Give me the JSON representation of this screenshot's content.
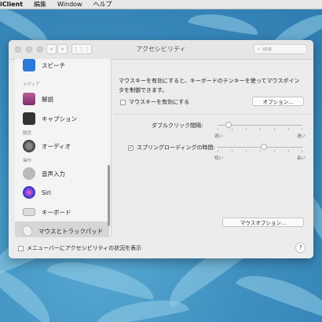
{
  "menubar": {
    "app_name": "iClient",
    "items": [
      "編集",
      "Window",
      "ヘルプ"
    ]
  },
  "window": {
    "title": "アクセシビリティ",
    "search_placeholder": "検索",
    "nav_back": "‹",
    "nav_forward": "›"
  },
  "sidebar": {
    "sections": {
      "media": "メディア",
      "hearing": "聴覚",
      "interaction": "操作"
    },
    "items": [
      {
        "label": "スピーチ",
        "icon": "speech-bubble-icon"
      },
      {
        "label": "解説",
        "icon": "descriptions-icon"
      },
      {
        "label": "キャプション",
        "icon": "captions-icon"
      },
      {
        "label": "オーディオ",
        "icon": "speaker-icon"
      },
      {
        "label": "音声入力",
        "icon": "microphone-icon"
      },
      {
        "label": "Siri",
        "icon": "siri-icon"
      },
      {
        "label": "キーボード",
        "icon": "keyboard-icon"
      },
      {
        "label": "マウスとトラックパッド",
        "icon": "mouse-icon"
      }
    ],
    "selected": "マウスとトラックパッド"
  },
  "main": {
    "mouse_keys_description": "マウスキーを有効にすると、キーボードのテンキーを使ってマウスポインタを制御できます。",
    "enable_mouse_keys_label": "マウスキーを有効にする",
    "enable_mouse_keys_checked": false,
    "options_button": "オプション...",
    "double_click_label": "ダブルクリック間隔:",
    "double_click_min": "遅い",
    "double_click_max": "速い",
    "double_click_value": 0.13,
    "spring_loading_label": "スプリングローディングの時間:",
    "spring_loading_checked": true,
    "spring_min": "短い",
    "spring_max": "長い",
    "spring_value": 0.55,
    "mouse_options_button": "マウスオプション..."
  },
  "footer": {
    "show_in_menubar_label": "メニューバーにアクセシビリティの状況を表示",
    "show_in_menubar_checked": false,
    "help_label": "?"
  },
  "colors": {
    "window_bg": "#ececec",
    "sidebar_selected": "#d6d6d6",
    "wallpaper": "#3f8fbd"
  }
}
